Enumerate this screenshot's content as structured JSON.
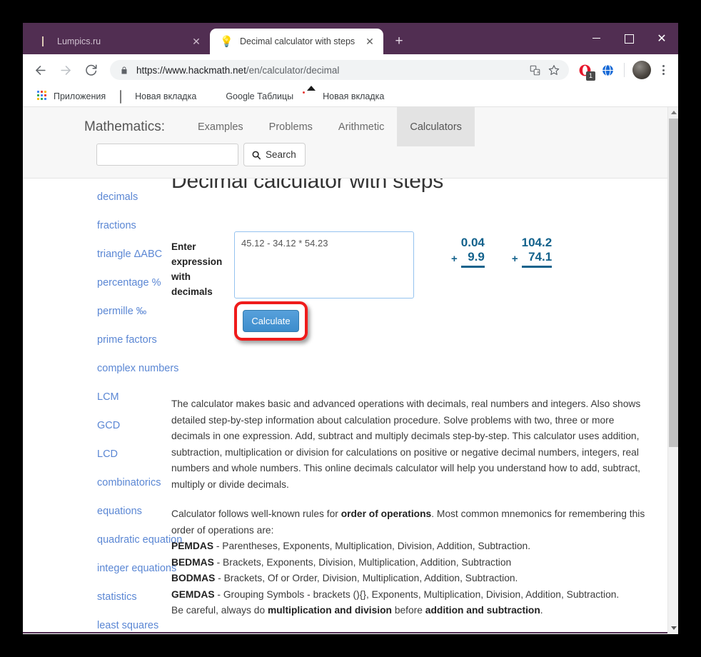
{
  "browser": {
    "tabs": [
      {
        "title": "Lumpics.ru",
        "favicon": "orange-circle-icon",
        "active": false,
        "close_label": "✕"
      },
      {
        "title": "Decimal calculator with steps",
        "favicon": "lightbulb-icon",
        "active": true,
        "close_label": "✕"
      }
    ],
    "new_tab_label": "+",
    "window_controls": {
      "minimize": "–",
      "maximize": "□",
      "close": "✕"
    },
    "toolbar": {
      "back_label": "Back",
      "forward_label": "Forward",
      "reload_label": "Reload",
      "url_host": "https://www.hackmath.net",
      "url_path": "/en/calculator/decimal",
      "extension_badge": "1"
    },
    "bookmarks": [
      {
        "label": "Приложения",
        "icon": "apps-grid-icon"
      },
      {
        "label": "Новая вкладка",
        "icon": "document-icon"
      },
      {
        "label": "Google Таблицы",
        "icon": "sheets-icon"
      },
      {
        "label": "Новая вкладка",
        "icon": "image-icon"
      }
    ]
  },
  "site": {
    "brand": "Mathematics:",
    "nav": [
      {
        "label": "Examples",
        "active": false
      },
      {
        "label": "Problems",
        "active": false
      },
      {
        "label": "Arithmetic",
        "active": false
      },
      {
        "label": "Calculators",
        "active": true
      }
    ],
    "search": {
      "value": "",
      "placeholder": "",
      "button_label": "Search"
    },
    "sidebar": [
      "decimals",
      "fractions",
      "triangle ΔABC",
      "percentage %",
      "permille ‰",
      "prime factors",
      "complex numbers",
      "LCM",
      "GCD",
      "LCD",
      "combinatorics",
      "equations",
      "quadratic equation",
      "integer equations",
      "statistics",
      "least squares"
    ],
    "page_title": "Decimal calculator with steps",
    "form": {
      "label": "Enter expression with decimals",
      "expression_value": "45.12 - 34.12 * 54.23",
      "calculate_label": "Calculate"
    },
    "math_deco": [
      {
        "op": "+",
        "top": "0.04",
        "bottom": "9.9"
      },
      {
        "op": "+",
        "top": "104.2",
        "bottom": "74.1"
      }
    ],
    "prose": {
      "paragraph1": "The calculator makes basic and advanced operations with decimals, real numbers and integers. Also shows detailed step-by-step information about calculation procedure. Solve problems with two, three or more decimals in one expression. Add, subtract and multiply decimals step-by-step. This calculator uses addition, subtraction, multiplication or division for calculations on positive or negative decimal numbers, integers, real numbers and whole numbers. This online decimals calculator will help you understand how to add, subtract, multiply or divide decimals.",
      "p2_intro_a": "Calculator follows well-known rules for ",
      "p2_bold_a": "order of operations",
      "p2_intro_b": ". Most common mnemonics for remembering this order of operations are:",
      "mnemonics": [
        {
          "name": "PEMDAS",
          "text": " - Parentheses, Exponents, Multiplication, Division, Addition, Subtraction."
        },
        {
          "name": "BEDMAS",
          "text": " - Brackets, Exponents, Division, Multiplication, Addition, Subtraction"
        },
        {
          "name": "BODMAS",
          "text": " - Brackets, Of or Order, Division, Multiplication, Addition, Subtraction."
        },
        {
          "name": "GEMDAS",
          "text": " - Grouping Symbols - brackets (){}, Exponents, Multiplication, Division, Addition, Subtraction."
        }
      ],
      "warn_a": "Be careful, always do ",
      "warn_bold_a": "multiplication and division",
      "warn_b": " before ",
      "warn_bold_b": "addition and subtraction",
      "warn_c": "."
    }
  },
  "colors": {
    "chrome_purple": "#512E52",
    "link_blue": "#5b87d4",
    "button_blue": "#3d8dcc",
    "highlight_red": "#ef1b1b",
    "math_teal": "#13628c"
  }
}
